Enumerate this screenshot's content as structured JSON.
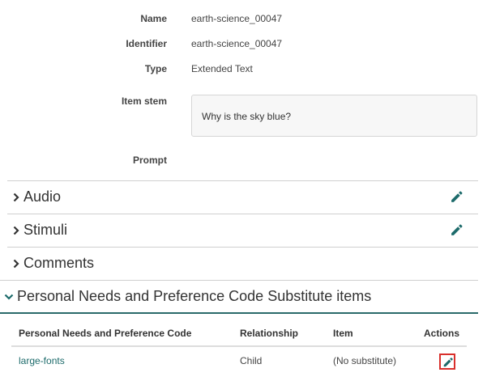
{
  "fields": {
    "name_label": "Name",
    "name_value": "earth-science_00047",
    "identifier_label": "Identifier",
    "identifier_value": "earth-science_00047",
    "type_label": "Type",
    "type_value": "Extended Text",
    "stem_label": "Item stem",
    "stem_value": "Why is the sky blue?",
    "prompt_label": "Prompt"
  },
  "sections": {
    "audio": "Audio",
    "stimuli": "Stimuli",
    "comments": "Comments",
    "pnp": "Personal Needs and Preference Code Substitute items"
  },
  "pnp_table": {
    "headers": [
      "Personal Needs and Preference Code",
      "Relationship",
      "Item",
      "Actions"
    ],
    "rows": [
      {
        "code": "large-fonts",
        "relationship": "Child",
        "item": "(No substitute)"
      }
    ]
  },
  "colors": {
    "accent": "#1d6b6b",
    "highlight_border": "#d9302c"
  },
  "icons": {
    "collapsed_chevron": "chevron-right-icon",
    "expanded_chevron": "chevron-down-icon",
    "edit": "pencil-icon"
  }
}
